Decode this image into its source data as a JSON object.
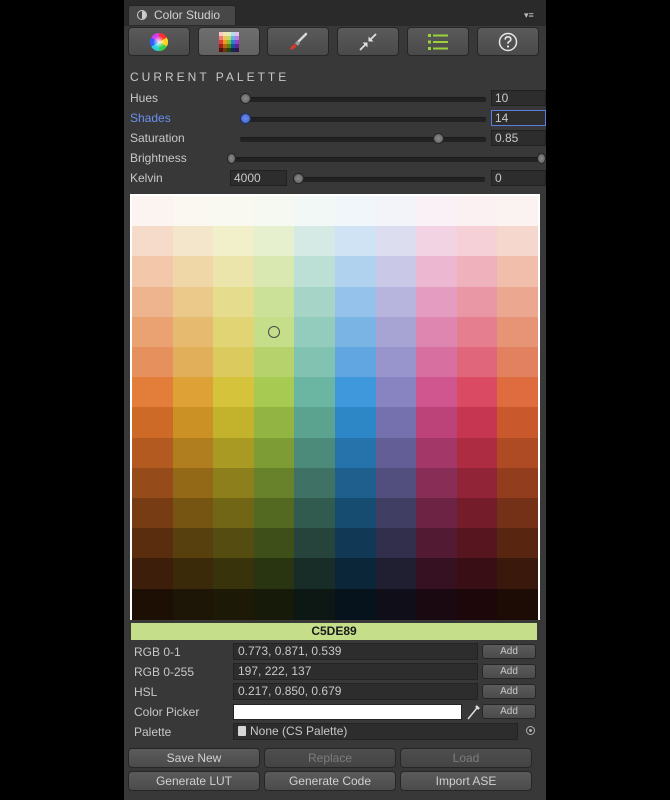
{
  "window": {
    "tab_title": "Color Studio",
    "menu_icon": "menu-icon"
  },
  "toolbar": {
    "buttons": [
      {
        "name": "color-wheel",
        "icon": "color-wheel-icon"
      },
      {
        "name": "palette-grid",
        "icon": "palette-grid-icon",
        "active": true
      },
      {
        "name": "paintbrush",
        "icon": "paintbrush-icon"
      },
      {
        "name": "compress",
        "icon": "compress-arrows-icon"
      },
      {
        "name": "list",
        "icon": "list-icon"
      },
      {
        "name": "help",
        "icon": "help-icon"
      }
    ]
  },
  "palette": {
    "section_title": "CURRENT PALETTE",
    "sliders": [
      {
        "label": "Hues",
        "value": "10",
        "level": 0.0
      },
      {
        "label": "Shades",
        "value": "14",
        "level": 0.0
      },
      {
        "label": "Saturation",
        "value": "0.85",
        "level": 0.85
      },
      {
        "label": "Brightness",
        "level": 0.0
      },
      {
        "label": "Kelvin",
        "min_value": "4000",
        "value": "0",
        "level": 0.0
      }
    ]
  },
  "grid": {
    "columns": 10,
    "rows": 14,
    "selected": {
      "row": 4,
      "col": 3
    },
    "selected_hex": "C5DE89",
    "selected_color": "#C5DE89",
    "colors": [
      [
        "#FBF4F1",
        "#FBF7F1",
        "#FAF9F1",
        "#F6F9F1",
        "#F1F8F6",
        "#F1F6FB",
        "#F3F3FA",
        "#FAF1F6",
        "#FBF1F3",
        "#FBF3F1"
      ],
      [
        "#F6DBCB",
        "#F4E6CA",
        "#F2EFCB",
        "#E6F0CE",
        "#D5EAE4",
        "#CFE3F5",
        "#DDDDF0",
        "#F2D3E3",
        "#F5D0D7",
        "#F5D7CD"
      ],
      [
        "#F2C7AA",
        "#EFD7A7",
        "#ECE5AB",
        "#D9E8B0",
        "#BCDFD6",
        "#B0D2EF",
        "#C9C8E6",
        "#EBB7D1",
        "#EFB2BC",
        "#F0BEAB"
      ],
      [
        "#EEB48D",
        "#EAC98A",
        "#E6DC8E",
        "#CBE198",
        "#A6D5C8",
        "#94C2EA",
        "#B7B5DD",
        "#E49DC0",
        "#EA97A5",
        "#EBA790"
      ],
      [
        "#EAA273",
        "#E6BB70",
        "#E1D475",
        "#C5DE89",
        "#93CCBC",
        "#79B4E5",
        "#A7A4D4",
        "#DE86B0",
        "#E57E8F",
        "#E79376"
      ],
      [
        "#E6915D",
        "#E1AE5A",
        "#DBCB5F",
        "#B5D26D",
        "#82C2B0",
        "#61A6E0",
        "#9894CC",
        "#D770A1",
        "#E0667B",
        "#E28160"
      ],
      [
        "#E37D3A",
        "#DDA136",
        "#D6C33C",
        "#A7CA53",
        "#6BB6A2",
        "#3E98DB",
        "#8884C2",
        "#D0568F",
        "#DB4A63",
        "#DE6C3E"
      ],
      [
        "#CE6A28",
        "#CB9125",
        "#C3B22B",
        "#92B442",
        "#5BA28F",
        "#2D86C5",
        "#7571AE",
        "#BC437A",
        "#C73650",
        "#C9592C"
      ],
      [
        "#B35A20",
        "#B07E1E",
        "#A99A23",
        "#7D9C36",
        "#4C8A79",
        "#2573AA",
        "#635F96",
        "#A33767",
        "#AE2C42",
        "#AE4B24"
      ],
      [
        "#964B1A",
        "#936918",
        "#8D801C",
        "#68822C",
        "#3F7264",
        "#1E5F8D",
        "#524E7D",
        "#882D55",
        "#912436",
        "#923E1E"
      ],
      [
        "#783C14",
        "#765412",
        "#716616",
        "#536922",
        "#325B50",
        "#174C71",
        "#413E64",
        "#6D2344",
        "#741C2A",
        "#753117"
      ],
      [
        "#5A2D0F",
        "#583F0E",
        "#554C11",
        "#3E4F1A",
        "#26443C",
        "#113955",
        "#312F4B",
        "#521A33",
        "#571520",
        "#582511"
      ],
      [
        "#3C1E0A",
        "#3B2A09",
        "#38330B",
        "#293511",
        "#192D28",
        "#0B2638",
        "#201F32",
        "#361122",
        "#3A0E15",
        "#3A180B"
      ],
      [
        "#1E0F05",
        "#1D1505",
        "#1C1906",
        "#151A09",
        "#0D1714",
        "#06131C",
        "#100F19",
        "#1B0911",
        "#1D070B",
        "#1D0C06"
      ]
    ]
  },
  "properties": {
    "rgb01": {
      "label": "RGB 0-1",
      "value": "0.773, 0.871, 0.539",
      "add": "Add"
    },
    "rgb255": {
      "label": "RGB 0-255",
      "value": "197, 222, 137",
      "add": "Add"
    },
    "hsl": {
      "label": "HSL",
      "value": "0.217, 0.850, 0.679",
      "add": "Add"
    },
    "picker": {
      "label": "Color Picker",
      "add": "Add",
      "color": "#FFFFFF"
    },
    "palette": {
      "label": "Palette",
      "value": "None (CS Palette)"
    }
  },
  "buttons": {
    "save_new": "Save New",
    "replace": "Replace",
    "load": "Load",
    "generate_lut": "Generate LUT",
    "generate_code": "Generate Code",
    "import_ase": "Import ASE"
  }
}
